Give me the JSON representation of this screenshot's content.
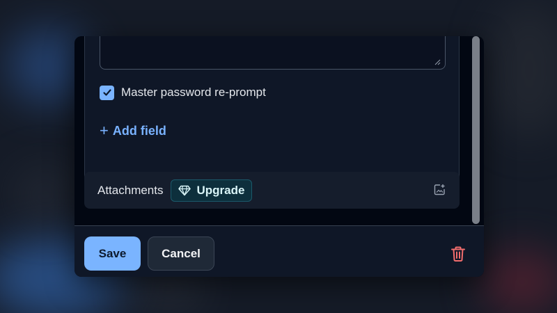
{
  "form": {
    "reprompt_label": "Master password re-prompt",
    "reprompt_checked": true,
    "add_field_label": "Add field"
  },
  "attachments": {
    "label": "Attachments",
    "upgrade_label": "Upgrade"
  },
  "footer": {
    "save_label": "Save",
    "cancel_label": "Cancel"
  },
  "colors": {
    "accent": "#7ab4ff",
    "danger": "#f26d6d",
    "upgrade_bg": "#0d2f3c"
  },
  "icons": [
    "resize-grip-icon",
    "checkmark-icon",
    "plus-icon",
    "diamond-icon",
    "add-attachment-icon",
    "trash-icon"
  ]
}
